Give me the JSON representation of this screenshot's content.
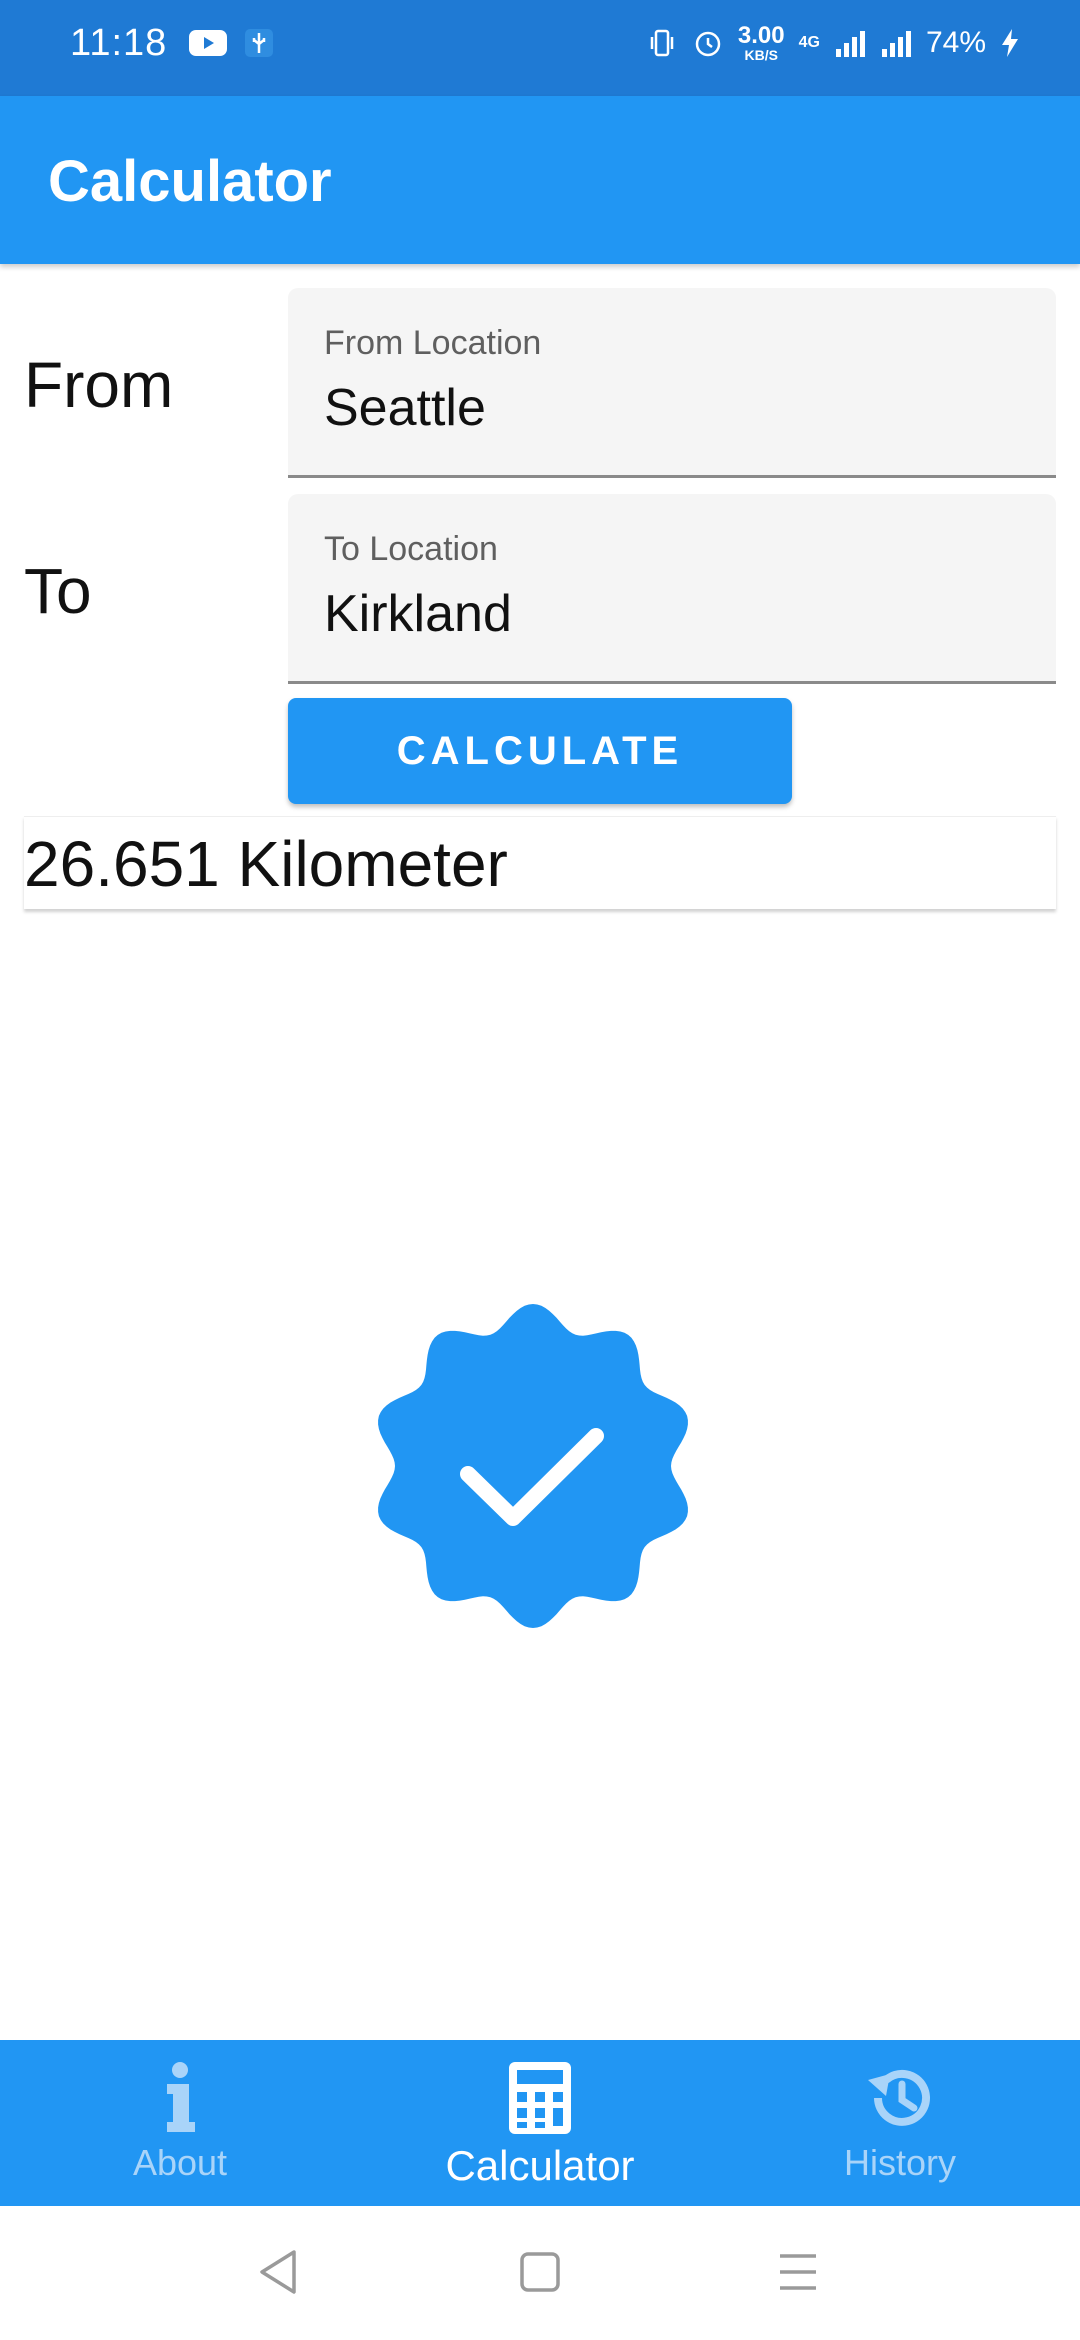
{
  "status_bar": {
    "time": "11:18",
    "network_speed_value": "3.00",
    "network_speed_unit": "KB/S",
    "network_type": "4G",
    "battery": "74%"
  },
  "app_bar": {
    "title": "Calculator"
  },
  "form": {
    "from_label": "From",
    "from_field_caption": "From Location",
    "from_field_value": "Seattle",
    "to_label": "To",
    "to_field_caption": "To Location",
    "to_field_value": "Kirkland",
    "calculate_label": "CALCULATE"
  },
  "result": {
    "text": "26.651 Kilometer"
  },
  "bottom_nav": {
    "items": [
      {
        "label": "About",
        "icon": "info-icon",
        "active": false
      },
      {
        "label": "Calculator",
        "icon": "calculator-icon",
        "active": true
      },
      {
        "label": "History",
        "icon": "history-icon",
        "active": false
      }
    ]
  },
  "colors": {
    "primary": "#2196f3",
    "status_bar": "#1f7ad4",
    "nav_inactive": "#a9d4f9"
  }
}
